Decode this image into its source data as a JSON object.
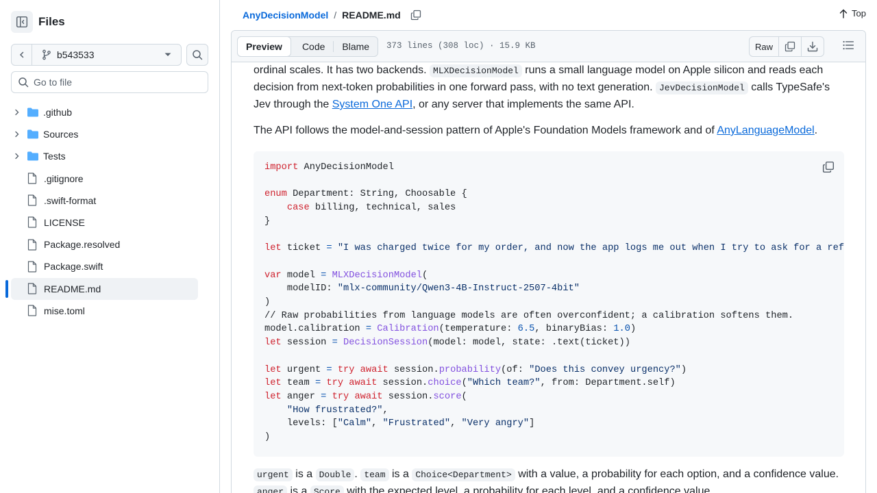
{
  "sidebar": {
    "title": "Files",
    "branch": "b543533",
    "goto_placeholder": "Go to file",
    "items": [
      {
        "name": ".github",
        "type": "folder"
      },
      {
        "name": "Sources",
        "type": "folder"
      },
      {
        "name": "Tests",
        "type": "folder"
      },
      {
        "name": ".gitignore",
        "type": "file"
      },
      {
        "name": ".swift-format",
        "type": "file"
      },
      {
        "name": "LICENSE",
        "type": "file"
      },
      {
        "name": "Package.resolved",
        "type": "file"
      },
      {
        "name": "Package.swift",
        "type": "file"
      },
      {
        "name": "README.md",
        "type": "file",
        "selected": true
      },
      {
        "name": "mise.toml",
        "type": "file"
      }
    ]
  },
  "header": {
    "repo": "AnyDecisionModel",
    "separator": "/",
    "file": "README.md",
    "top_label": "Top"
  },
  "file_header": {
    "tabs": [
      "Preview",
      "Code",
      "Blame"
    ],
    "active_tab": "Preview",
    "meta": "373 lines (308 loc) · 15.9 KB",
    "raw_label": "Raw"
  },
  "readme": {
    "p1": {
      "t1": "ordinal scales. It has two backends. ",
      "c1": "MLXDecisionModel",
      "t2": " runs a small language model on Apple silicon and reads each decision from next-token probabilities in one forward pass, with no text generation. ",
      "c2": "JevDecisionModel",
      "t3": " calls TypeSafe's Jev through the ",
      "link": "System One API",
      "t4": ", or any server that implements the same API."
    },
    "p2": {
      "t1": "The API follows the model-and-session pattern of Apple's Foundation Models framework and of ",
      "link": "AnyLanguageModel",
      "t2": "."
    },
    "p3": {
      "c1": "urgent",
      "t1": " is a ",
      "c2": "Double",
      "t2": ". ",
      "c3": "team",
      "t3": " is a ",
      "c4": "Choice<Department>",
      "t4": " with a value, a probability for each option, and a confidence value. ",
      "c5": "anger",
      "t5": " is a ",
      "c6": "Score",
      "t6": " with the expected level, a probability for each level, and a confidence value."
    },
    "code_lines": [
      [
        [
          "kw",
          "import"
        ],
        [
          "tx",
          " AnyDecisionModel"
        ]
      ],
      [],
      [
        [
          "kw",
          "enum"
        ],
        [
          "tx",
          " Department: String, Choosable {"
        ]
      ],
      [
        [
          "tx",
          "    "
        ],
        [
          "kw",
          "case"
        ],
        [
          "tx",
          " billing, technical, sales"
        ]
      ],
      [
        [
          "tx",
          "}"
        ]
      ],
      [],
      [
        [
          "kw",
          "let"
        ],
        [
          "tx",
          " ticket "
        ],
        [
          "nb",
          "="
        ],
        [
          "tx",
          " "
        ],
        [
          "st",
          "\"I was charged twice for my order, and now the app logs me out when I try to ask for a refund.\""
        ]
      ],
      [],
      [
        [
          "kw",
          "var"
        ],
        [
          "tx",
          " model "
        ],
        [
          "nb",
          "="
        ],
        [
          "tx",
          " "
        ],
        [
          "fn",
          "MLXDecisionModel"
        ],
        [
          "tx",
          "("
        ]
      ],
      [
        [
          "tx",
          "    modelID: "
        ],
        [
          "st",
          "\"mlx-community/Qwen3-4B-Instruct-2507-4bit\""
        ]
      ],
      [
        [
          "tx",
          ")"
        ]
      ],
      [
        [
          "cm",
          "// Raw probabilities from language models are often overconfident; a calibration softens them."
        ]
      ],
      [
        [
          "tx",
          "model.calibration "
        ],
        [
          "nb",
          "="
        ],
        [
          "tx",
          " "
        ],
        [
          "fn",
          "Calibration"
        ],
        [
          "tx",
          "(temperature: "
        ],
        [
          "nb",
          "6.5"
        ],
        [
          "tx",
          ", binaryBias: "
        ],
        [
          "nb",
          "1.0"
        ],
        [
          "tx",
          ")"
        ]
      ],
      [
        [
          "kw",
          "let"
        ],
        [
          "tx",
          " session "
        ],
        [
          "nb",
          "="
        ],
        [
          "tx",
          " "
        ],
        [
          "fn",
          "DecisionSession"
        ],
        [
          "tx",
          "(model: model, state: .text(ticket))"
        ]
      ],
      [],
      [
        [
          "kw",
          "let"
        ],
        [
          "tx",
          " urgent "
        ],
        [
          "nb",
          "="
        ],
        [
          "tx",
          " "
        ],
        [
          "kw",
          "try await"
        ],
        [
          "tx",
          " session."
        ],
        [
          "fn",
          "probability"
        ],
        [
          "tx",
          "(of: "
        ],
        [
          "st",
          "\"Does this convey urgency?\""
        ],
        [
          "tx",
          ")"
        ]
      ],
      [
        [
          "kw",
          "let"
        ],
        [
          "tx",
          " team "
        ],
        [
          "nb",
          "="
        ],
        [
          "tx",
          " "
        ],
        [
          "kw",
          "try await"
        ],
        [
          "tx",
          " session."
        ],
        [
          "fn",
          "choice"
        ],
        [
          "tx",
          "("
        ],
        [
          "st",
          "\"Which team?\""
        ],
        [
          "tx",
          ", from: Department.self)"
        ]
      ],
      [
        [
          "kw",
          "let"
        ],
        [
          "tx",
          " anger "
        ],
        [
          "nb",
          "="
        ],
        [
          "tx",
          " "
        ],
        [
          "kw",
          "try await"
        ],
        [
          "tx",
          " session."
        ],
        [
          "fn",
          "score"
        ],
        [
          "tx",
          "("
        ]
      ],
      [
        [
          "tx",
          "    "
        ],
        [
          "st",
          "\"How frustrated?\""
        ],
        [
          "tx",
          ","
        ]
      ],
      [
        [
          "tx",
          "    levels: ["
        ],
        [
          "st",
          "\"Calm\""
        ],
        [
          "tx",
          ", "
        ],
        [
          "st",
          "\"Frustrated\""
        ],
        [
          "tx",
          ", "
        ],
        [
          "st",
          "\"Very angry\""
        ],
        [
          "tx",
          "]"
        ]
      ],
      [
        [
          "tx",
          ")"
        ]
      ]
    ]
  },
  "colors": {
    "accent": "#0969da",
    "keyword": "#cf222e",
    "string": "#0a3069",
    "function": "#8250df",
    "number": "#0550ae",
    "border": "#d1d9e0",
    "code_bg": "#f6f8fa"
  }
}
